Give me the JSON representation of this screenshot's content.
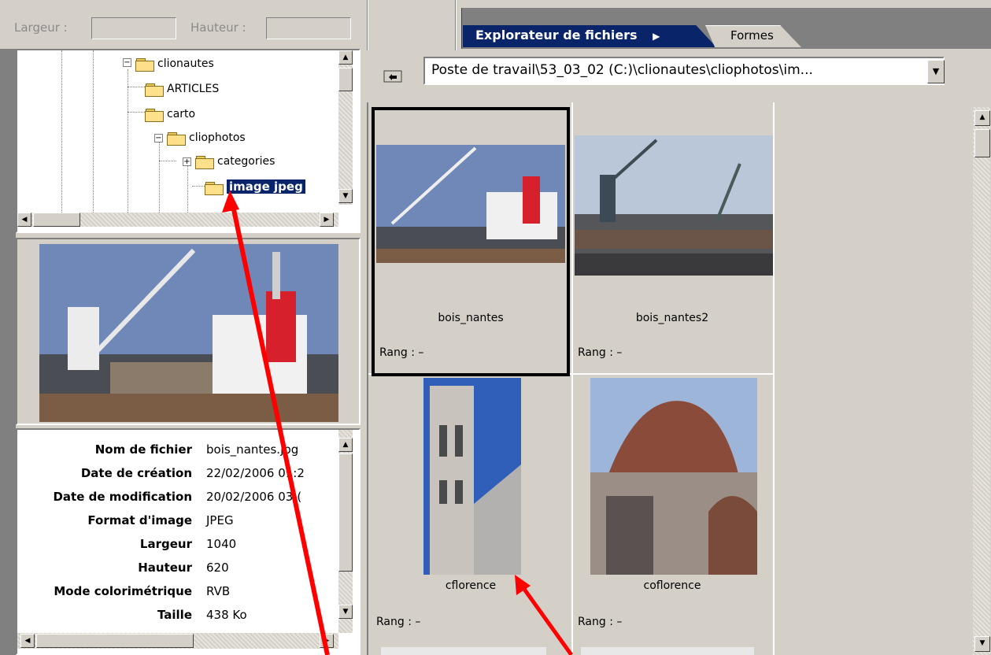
{
  "toolbar": {
    "width_label": "Largeur :",
    "height_label": "Hauteur :",
    "width_value": "",
    "height_value": ""
  },
  "tabs": [
    {
      "label": "Explorateur de fichiers",
      "active": true
    },
    {
      "label": "Formes",
      "active": false
    }
  ],
  "tab_arrow_icon": "right-triangle",
  "tree": {
    "items": [
      {
        "label": "clionautes",
        "expanded": true
      },
      {
        "label": "ARTICLES"
      },
      {
        "label": "carto"
      },
      {
        "label": "cliophotos",
        "expanded": true
      },
      {
        "label": "categories",
        "expandable": true
      },
      {
        "label": "image jpeg",
        "selected": true
      }
    ]
  },
  "metadata": {
    "rows": [
      {
        "key": "Nom de fichier",
        "value": "bois_nantes.jpg"
      },
      {
        "key": "Date de création",
        "value": "22/02/2006 01:2"
      },
      {
        "key": "Date de modification",
        "value": "20/02/2006 03:("
      },
      {
        "key": "Format d'image",
        "value": "JPEG"
      },
      {
        "key": "Largeur",
        "value": "1040"
      },
      {
        "key": "Hauteur",
        "value": "620"
      },
      {
        "key": "Mode colorimétrique",
        "value": "RVB"
      },
      {
        "key": "Taille",
        "value": "438 Ko"
      }
    ]
  },
  "path": {
    "value": "Poste de travail\\53_03_02 (C:)\\clionautes\\cliophotos\\im..."
  },
  "thumbnails": [
    {
      "name": "bois_nantes",
      "rank": "Rang :  –",
      "selected": true
    },
    {
      "name": "bois_nantes2",
      "rank": "Rang :  –"
    },
    {
      "name": "cflorence",
      "rank": "Rang :  –"
    },
    {
      "name": "coflorence",
      "rank": "Rang :  –"
    }
  ],
  "colors": {
    "selection": "#0a246a",
    "annotation_arrow": "#ff0000",
    "window_bg": "#d4d0c8"
  }
}
